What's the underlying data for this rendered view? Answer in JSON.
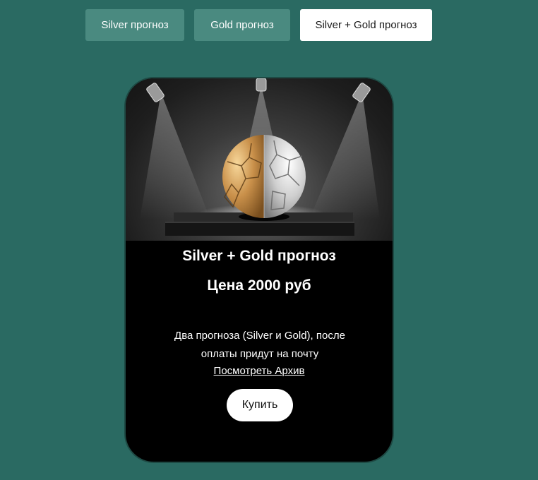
{
  "tabs": [
    {
      "label": "Silver прогноз",
      "active": false
    },
    {
      "label": "Gold прогноз",
      "active": false
    },
    {
      "label": "Silver + Gold прогноз",
      "active": true
    }
  ],
  "card": {
    "title": "Silver + Gold прогноз",
    "price": "Цена 2000 руб",
    "description_line1": "Два прогноза (Silver и Gold), после",
    "description_line2": "оплаты придут на почту",
    "archive_link": "Посмотреть Архив",
    "buy_label": "Купить",
    "image_icon": "gold-silver-soccer-ball-on-pedestal"
  },
  "colors": {
    "background": "#2a6a62",
    "tab_inactive": "#4a8a80",
    "tab_active": "#ffffff",
    "card": "#000000"
  }
}
